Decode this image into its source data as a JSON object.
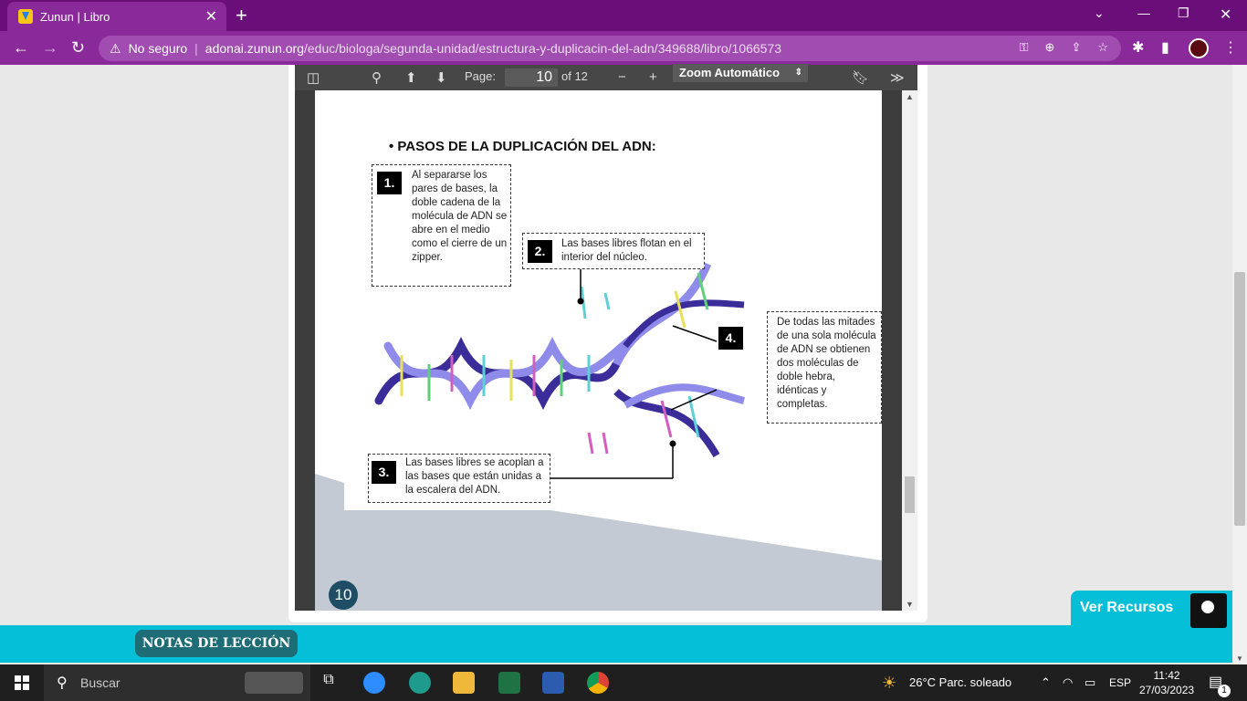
{
  "browser": {
    "tab_title": "Zunun | Libro",
    "security": "No seguro",
    "url_domain": "adonai.zunun.org",
    "url_path": "/educ/biologa/segunda-unidad/estructura-y-duplicacin-del-adn/349688/libro/1066573"
  },
  "pdf_toolbar": {
    "page_label": "Page:",
    "page_value": "10",
    "page_total": "of 12",
    "zoom": "Zoom Automático"
  },
  "page": {
    "title": "• PASOS DE LA DUPLICACIÓN DEL ADN:",
    "step1_num": "1.",
    "step1_text": "Al separarse los pares de bases, la doble cadena de la molécula de ADN se abre en el medio como el cierre de un zipper.",
    "step2_num": "2.",
    "step2_text": "Las bases libres flotan en el interior del núcleo.",
    "step3_num": "3.",
    "step3_text": "Las bases libres se acoplan a las bases que están unidas a la escalera del ADN.",
    "step4_num": "4.",
    "step4_text": "De todas las mitades de una sola molécula de ADN se obtienen dos moléculas de doble hebra, idénticas y completas.",
    "page_number": "10"
  },
  "lesson": {
    "notas_label": "NOTAS DE LECCIÓN",
    "recursos_label": "Ver Recursos"
  },
  "taskbar": {
    "search": "Buscar",
    "weather": "26°C  Parc. soleado",
    "lang": "ESP",
    "time": "11:42",
    "date": "27/03/2023",
    "notif_count": "1"
  }
}
